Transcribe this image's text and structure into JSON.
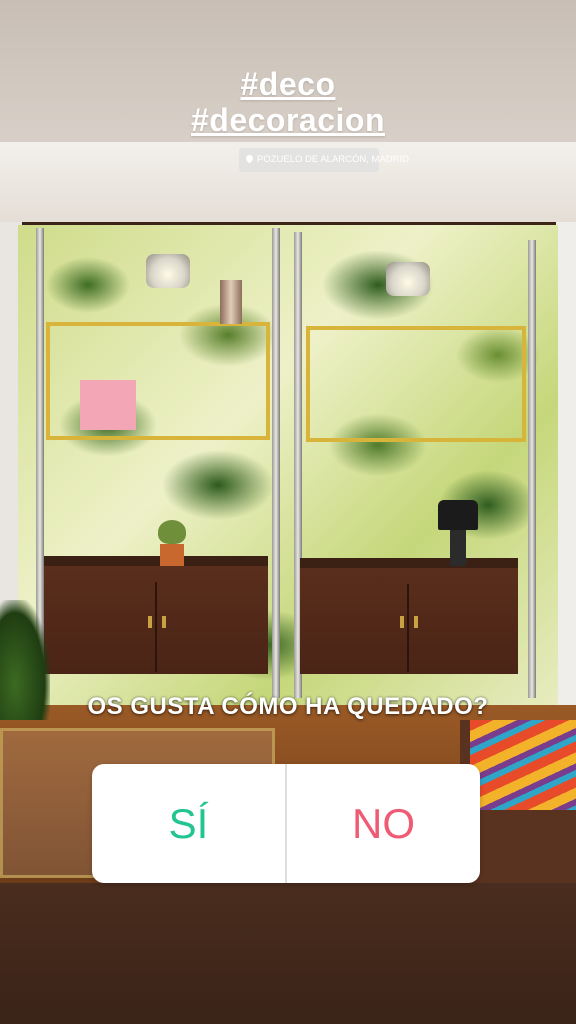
{
  "story": {
    "hashtags": [
      "#deco",
      "#decoracion"
    ],
    "location": "POZUELO DE ALARCÓN, MADRID",
    "poll": {
      "question": "OS GUSTA CÓMO HA QUEDADO?",
      "option_yes": "SÍ",
      "option_no": "NO",
      "yes_color": "#22c492",
      "no_color": "#ef5b73"
    }
  }
}
